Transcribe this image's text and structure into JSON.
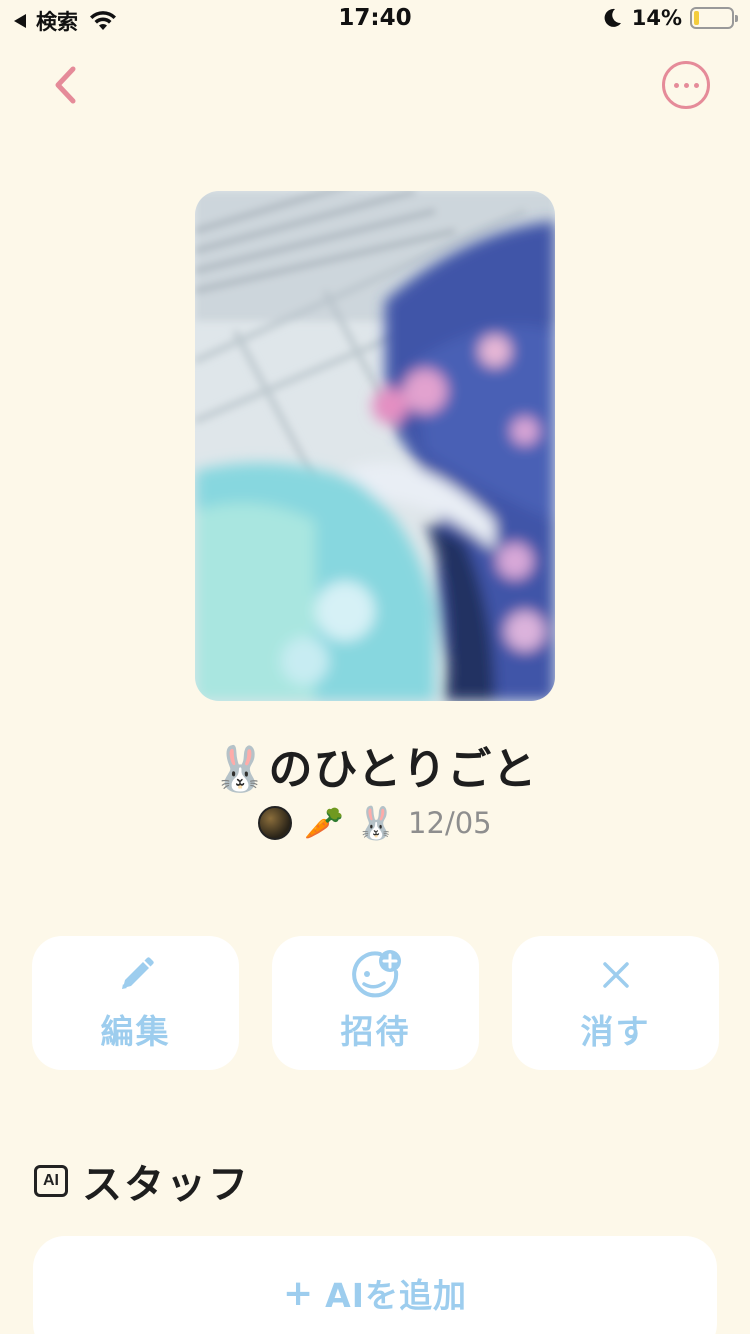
{
  "status_bar": {
    "back_app": "検索",
    "time": "17:40",
    "battery_percent": "14%",
    "battery_level": 0.14
  },
  "nav": {
    "back_icon": "chevron-left-icon",
    "more_icon": "ellipsis-circle-icon",
    "accent_color": "#e58b99"
  },
  "post": {
    "title": "🐰のひとりごと",
    "meta_emoji_1": "🥕",
    "meta_emoji_2": "🐰",
    "date": "12/05"
  },
  "actions": [
    {
      "label": "編集",
      "icon": "pencil-icon"
    },
    {
      "label": "招待",
      "icon": "invite-face-plus-icon"
    },
    {
      "label": "消す",
      "icon": "close-x-icon"
    }
  ],
  "staff": {
    "badge": "AI",
    "title": "スタッフ",
    "add_plus": "+",
    "add_label": "AIを追加"
  },
  "colors": {
    "background": "#fdf8e9",
    "button_text": "#9dcdee",
    "card": "#ffffff"
  }
}
